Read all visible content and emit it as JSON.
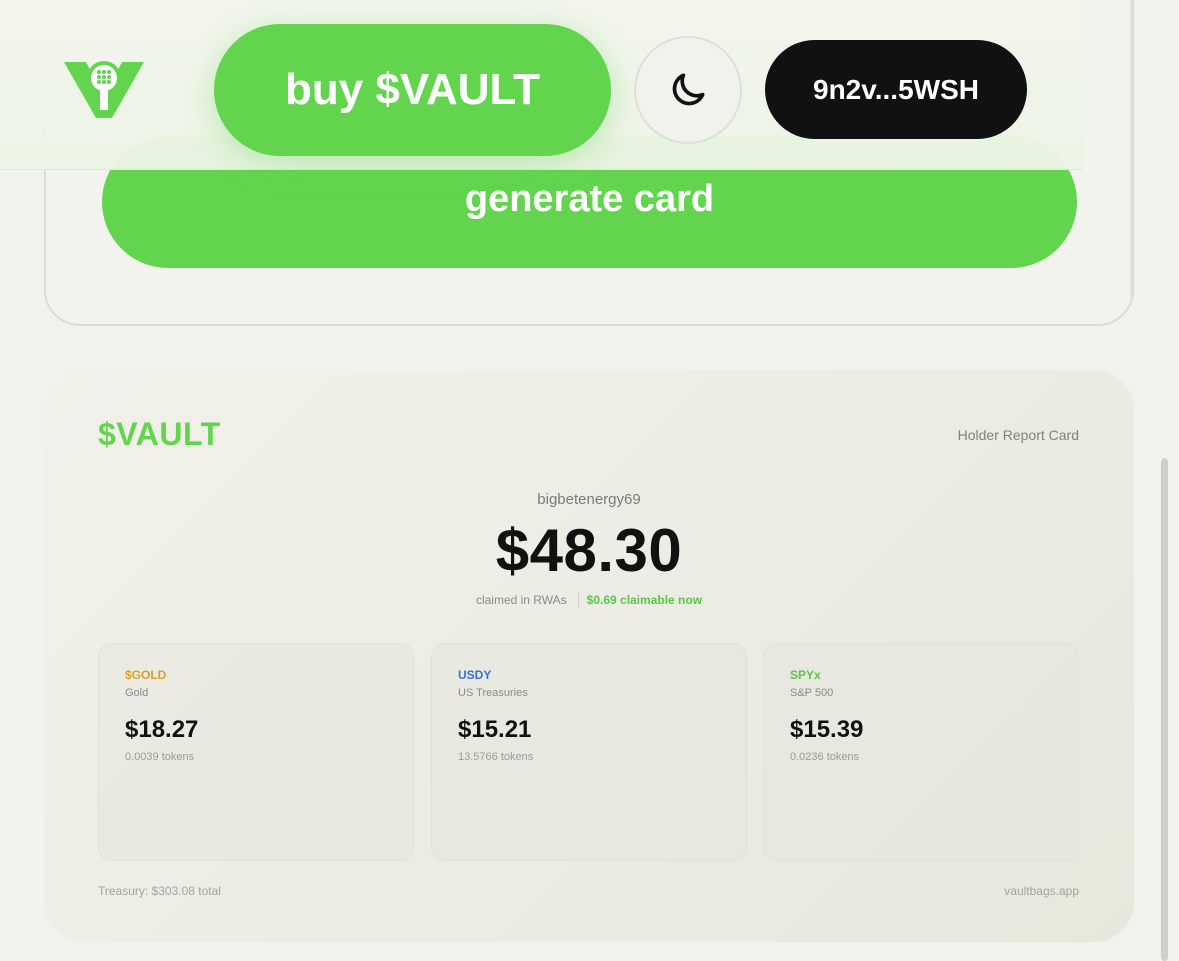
{
  "colors": {
    "accent": "#62d44e",
    "gold": "#d9a12a",
    "usdy": "#3a6fd8",
    "spyx": "#5ac748",
    "wallet_bg": "#111113"
  },
  "header": {
    "logo_icon": "vault-keyhole-logo-icon",
    "buy_label": "buy $VAULT",
    "theme_icon": "moon-icon",
    "wallet_label": "9n2v...5WSH"
  },
  "top_panel": {
    "generate_label": "generate card"
  },
  "report": {
    "brand": "$VAULT",
    "title": "Holder Report Card",
    "username": "bigbetenergy69",
    "total": "$48.30",
    "claimed_label": "claimed in RWAs",
    "claimable": "$0.69 claimable now",
    "assets": [
      {
        "symbol": "$GOLD",
        "name": "Gold",
        "value": "$18.27",
        "tokens": "0.0039 tokens",
        "color": "#d9a12a"
      },
      {
        "symbol": "USDY",
        "name": "US Treasuries",
        "value": "$15.21",
        "tokens": "13.5766 tokens",
        "color": "#3a6fd8"
      },
      {
        "symbol": "SPYx",
        "name": "S&P 500",
        "value": "$15.39",
        "tokens": "0.0236 tokens",
        "color": "#5ac748"
      }
    ],
    "treasury": "Treasury: $303.08 total",
    "site": "vaultbags.app"
  }
}
